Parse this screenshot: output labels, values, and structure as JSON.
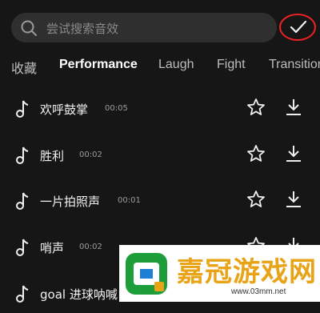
{
  "search": {
    "placeholder": "尝试搜索音效",
    "value": ""
  },
  "tabs": [
    {
      "label": "收藏",
      "active": false
    },
    {
      "label": "Performance",
      "active": true
    },
    {
      "label": "Laugh",
      "active": false
    },
    {
      "label": "Fight",
      "active": false
    },
    {
      "label": "Transition",
      "active": false
    }
  ],
  "sounds": [
    {
      "name": "欢呼鼓掌",
      "duration": "00:05"
    },
    {
      "name": "胜利",
      "duration": "00:02"
    },
    {
      "name": "一片拍照声",
      "duration": "00:01"
    },
    {
      "name": "哨声",
      "duration": "00:02"
    },
    {
      "name": "goal 进球呐喊",
      "duration": ""
    }
  ],
  "icons": {
    "search": "search-icon",
    "confirm": "check-icon",
    "note": "music-note-icon",
    "favorite": "star-outline-icon",
    "download": "download-icon"
  },
  "watermark": {
    "title": "嘉冠游戏网",
    "url": "www.03mm.net"
  },
  "colors": {
    "background": "#161616",
    "search_bg": "#2f2f2f",
    "highlight_ring": "#e22222",
    "watermark_accent": "#e8a317"
  }
}
